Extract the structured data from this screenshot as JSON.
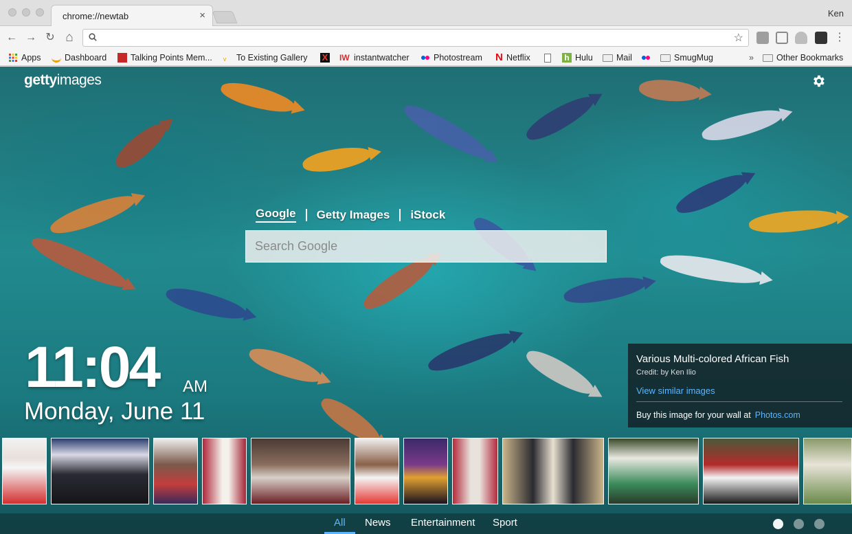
{
  "browser": {
    "tab_title": "chrome://newtab",
    "tab_close": "×",
    "profile_name": "Ken",
    "back_glyph": "←",
    "forward_glyph": "→",
    "reload_glyph": "↻",
    "home_glyph": "⌂",
    "star_glyph": "☆",
    "menu_glyph": "⋮",
    "more_glyph": "»"
  },
  "bookmarks": [
    {
      "label": "Apps",
      "icon": "apps-grid-icon"
    },
    {
      "label": "Dashboard",
      "icon": "dashboard-icon"
    },
    {
      "label": "Talking Points Mem...",
      "icon": "tpm-icon"
    },
    {
      "label": "To Existing Gallery",
      "icon": "gallery-icon"
    },
    {
      "label": "",
      "icon": "x-icon"
    },
    {
      "label": "instantwatcher",
      "icon": "iw-icon"
    },
    {
      "label": "Photostream",
      "icon": "flickr-icon"
    },
    {
      "label": "Netflix",
      "icon": "netflix-icon"
    },
    {
      "label": "",
      "icon": "page-icon"
    },
    {
      "label": "Hulu",
      "icon": "hulu-icon"
    },
    {
      "label": "Mail",
      "icon": "folder-icon"
    },
    {
      "label": "",
      "icon": "flickr-icon"
    },
    {
      "label": "SmugMug",
      "icon": "folder-icon"
    },
    {
      "label": "Other Bookmarks",
      "icon": "folder-icon"
    }
  ],
  "page": {
    "logo_bold": "getty",
    "logo_light": "images",
    "search_tabs": [
      "Google",
      "Getty Images",
      "iStock"
    ],
    "search_placeholder": "Search Google",
    "time": "11:04",
    "ampm": "AM",
    "date": "Monday, June 11",
    "info": {
      "title": "Various Multi-colored African Fish",
      "credit": "Credit: by Ken Ilio",
      "similar_link": "View similar images",
      "buy_text": "Buy this image for your wall at",
      "buy_link": "Photos.com"
    },
    "categories": [
      "All",
      "News",
      "Entertainment",
      "Sport"
    ],
    "active_category": "All",
    "pager": {
      "count": 3,
      "active": 1
    }
  },
  "colors": {
    "accent_link": "#5bb6ff",
    "water": "#218a8e"
  }
}
